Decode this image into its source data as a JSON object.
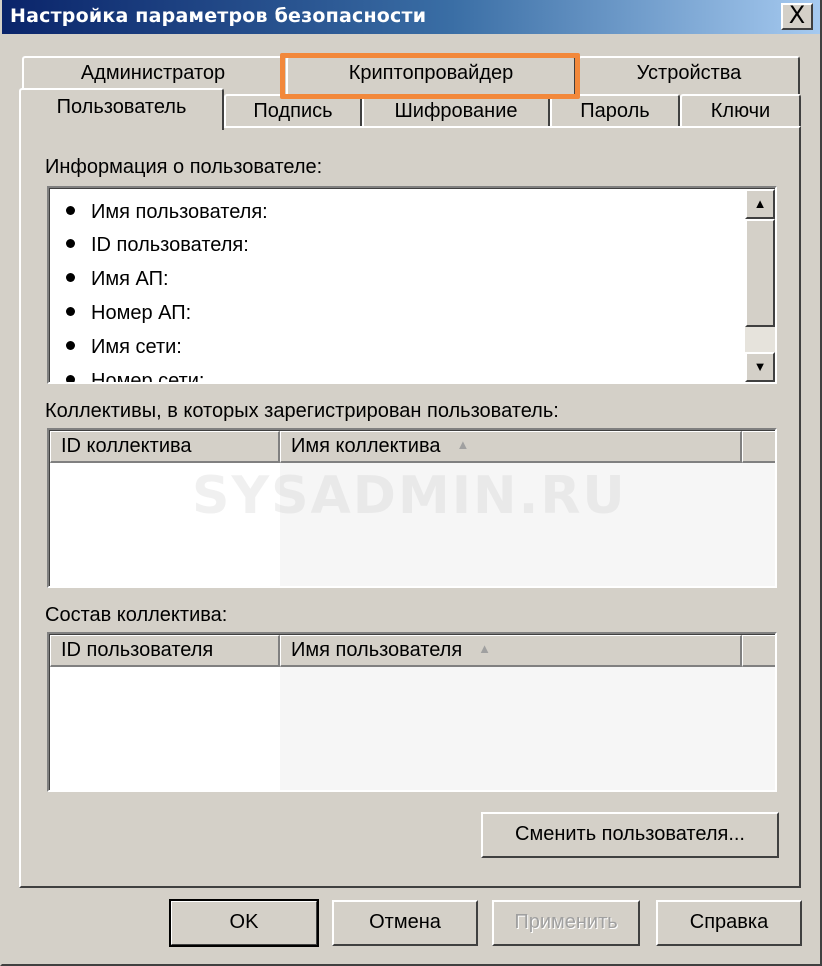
{
  "window": {
    "title": "Настройка параметров безопасности",
    "close_label": "X"
  },
  "tabs": {
    "row_back": [
      {
        "label": "Администратор"
      },
      {
        "label": "Криптопровайдер"
      },
      {
        "label": "Устройства"
      }
    ],
    "row_front": [
      {
        "label": "Пользователь",
        "active": true
      },
      {
        "label": "Подпись"
      },
      {
        "label": "Шифрование"
      },
      {
        "label": "Пароль"
      },
      {
        "label": "Ключи"
      }
    ]
  },
  "user_info": {
    "label": "Информация о пользователе:",
    "items": [
      "Имя пользователя:",
      "ID пользователя:",
      "Имя АП:",
      "Номер АП:",
      "Имя сети:",
      "Номер сети:"
    ]
  },
  "collectives": {
    "label": "Коллективы, в которых зарегистрирован пользователь:",
    "columns": [
      "ID коллектива",
      "Имя коллектива"
    ],
    "sort_indicator": "▲",
    "rows": []
  },
  "members": {
    "label": "Состав коллектива:",
    "columns": [
      "ID пользователя",
      "Имя пользователя"
    ],
    "sort_indicator": "▲",
    "rows": []
  },
  "buttons": {
    "change_user": "Сменить пользователя...",
    "ok": "OK",
    "cancel": "Отмена",
    "apply": "Применить",
    "help": "Справка"
  },
  "scrollbar": {
    "up_glyph": "▲",
    "down_glyph": "▼"
  },
  "watermark": "SYSADMIN.RU",
  "colors": {
    "highlight": "#f2883b",
    "title_start": "#0a246a",
    "title_end": "#a6caf0"
  }
}
